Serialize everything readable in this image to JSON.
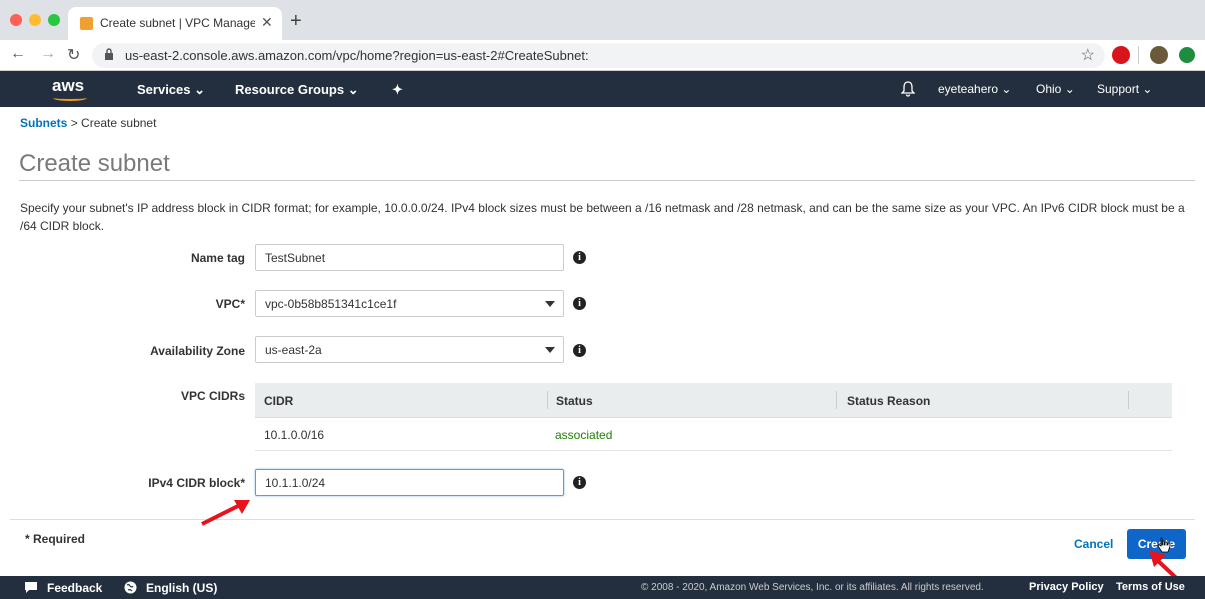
{
  "browser": {
    "tab_title": "Create subnet | VPC Managem",
    "url": "us-east-2.console.aws.amazon.com/vpc/home?region=us-east-2#CreateSubnet:"
  },
  "awsnav": {
    "logo": "aws",
    "services": "Services",
    "resource_groups": "Resource Groups",
    "user": "eyeteahero",
    "region": "Ohio",
    "support": "Support"
  },
  "breadcrumb": {
    "parent": "Subnets",
    "sep": ">",
    "current": "Create subnet"
  },
  "page_title": "Create subnet",
  "description": "Specify your subnet's IP address block in CIDR format; for example, 10.0.0.0/24. IPv4 block sizes must be between a /16 netmask and /28 netmask, and can be the same size as your VPC. An IPv6 CIDR block must be a /64 CIDR block.",
  "form": {
    "name_tag": {
      "label": "Name tag",
      "value": "TestSubnet"
    },
    "vpc": {
      "label": "VPC*",
      "value": "vpc-0b58b851341c1ce1f"
    },
    "az": {
      "label": "Availability Zone",
      "value": "us-east-2a"
    },
    "vpc_cidrs": {
      "label": "VPC CIDRs",
      "columns": [
        "CIDR",
        "Status",
        "Status Reason"
      ],
      "rows": [
        {
          "cidr": "10.1.0.0/16",
          "status": "associated",
          "reason": ""
        }
      ]
    },
    "ipv4": {
      "label": "IPv4 CIDR block*",
      "value": "10.1.1.0/24"
    }
  },
  "footer": {
    "required": "* Required",
    "cancel": "Cancel",
    "create": "Create"
  },
  "bottombar": {
    "feedback": "Feedback",
    "language": "English (US)",
    "copyright": "© 2008 - 2020, Amazon Web Services, Inc. or its affiliates. All rights reserved.",
    "privacy": "Privacy Policy",
    "terms": "Terms of Use"
  },
  "colors": {
    "aws_nav": "#232f3e",
    "aws_orange": "#ff9900",
    "link": "#0073bb",
    "primary_button": "#0f66c9",
    "associated": "#1d8102",
    "annotation_arrow": "#e8141b"
  }
}
